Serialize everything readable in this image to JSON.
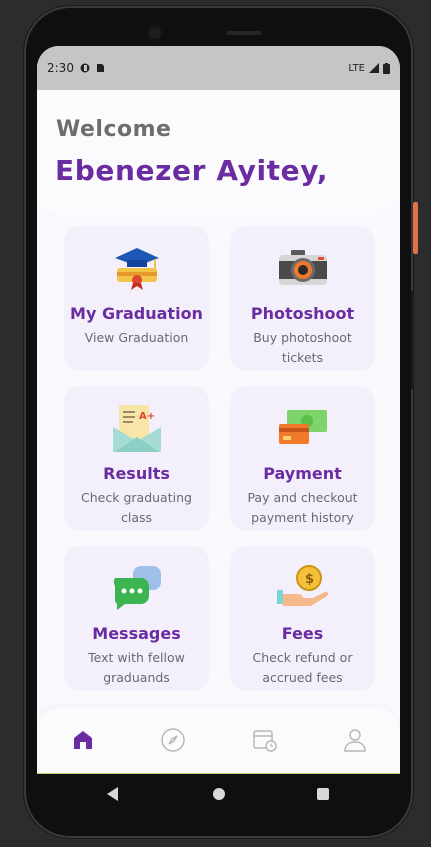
{
  "status_bar": {
    "time": "2:30",
    "network": "LTE"
  },
  "header": {
    "welcome": "Welcome",
    "user_name": "Ebenezer Ayitey,"
  },
  "cards": [
    {
      "title": "My Graduation",
      "subtitle": "View Graduation",
      "icon": "graduation-cap-icon"
    },
    {
      "title": "Photoshoot",
      "subtitle": "Buy photoshoot tickets",
      "icon": "camera-icon"
    },
    {
      "title": "Results",
      "subtitle": "Check graduating class",
      "icon": "results-envelope-icon"
    },
    {
      "title": "Payment",
      "subtitle": "Pay and checkout payment history",
      "icon": "payment-cards-icon"
    },
    {
      "title": "Messages",
      "subtitle": "Text with fellow graduands",
      "icon": "chat-bubbles-icon"
    },
    {
      "title": "Fees",
      "subtitle": "Check refund or accrued fees",
      "icon": "coin-hand-icon"
    }
  ],
  "bottom_nav": [
    {
      "name": "home-icon",
      "active": true
    },
    {
      "name": "compass-icon",
      "active": false
    },
    {
      "name": "calendar-clock-icon",
      "active": false
    },
    {
      "name": "profile-icon",
      "active": false
    }
  ],
  "colors": {
    "primary": "#6a2ca0",
    "card_bg": "#f3f0fc",
    "muted_text": "#6a6a6a"
  }
}
